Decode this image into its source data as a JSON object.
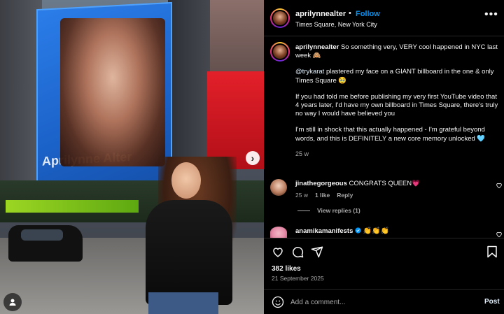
{
  "post": {
    "username": "aprilynnealter",
    "follow_label": "Follow",
    "separator": "•",
    "location": "Times Square, New York City",
    "more_label": "•••"
  },
  "photo": {
    "billboard_text": "Aprilynne Alter",
    "next_glyph": "›"
  },
  "caption": {
    "username": "aprilynnealter",
    "p1": "So something very, VERY cool happened in NYC last week 🙈",
    "p2_mention": "@trykarat",
    "p2_rest": " plastered my face on a GIANT billboard in the one & only Times Square 🥹",
    "p3": "If you had told me before publishing my very first YouTube video that 4 years later, I'd have my own billboard in Times Square, there's truly no way I would have believed you",
    "p4": "I'm still in shock that this actually happened - I'm grateful beyond words, and this is DEFINITELY a new core memory unlocked 🩵",
    "time": "25 w"
  },
  "comments": [
    {
      "username": "jinathegorgeous",
      "text": "CONGRATS QUEEN💗",
      "time": "25 w",
      "likes": "1 like",
      "reply_label": "Reply"
    },
    {
      "username": "anamikamanifests",
      "verified": true,
      "text": "👏👏👏"
    }
  ],
  "view_replies": "View replies (1)",
  "likes": "382 likes",
  "date": "21 September 2025",
  "add_comment": {
    "placeholder": "Add a comment...",
    "post_label": "Post"
  },
  "icons": {
    "like": "heart-icon",
    "comment": "comment-icon",
    "share": "share-icon",
    "save": "bookmark-icon",
    "emoji": "emoji-icon"
  },
  "colors": {
    "follow": "#0095f6",
    "verified": "#0095f6"
  }
}
